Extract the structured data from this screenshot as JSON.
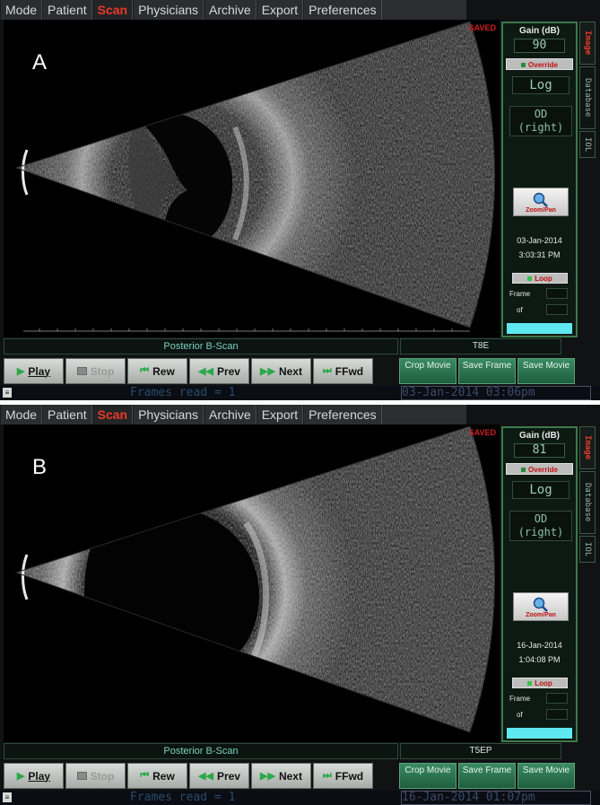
{
  "menu": [
    "Mode",
    "Patient",
    "Scan",
    "Physicians",
    "Archive",
    "Export",
    "Preferences"
  ],
  "active_menu": "Scan",
  "vertical_tabs": [
    "Image",
    "Database",
    "IOL"
  ],
  "controls": {
    "play": "Play",
    "stop": "Stop",
    "rew": "Rew",
    "prev": "Prev",
    "next": "Next",
    "ffwd": "FFwd"
  },
  "actions": {
    "crop_movie": "Crop Movie",
    "save_frame": "Save Frame",
    "save_movie": "Save Movie"
  },
  "sidebar_labels": {
    "gain": "Gain (dB)",
    "override": "Override",
    "zoom": "Zoom/Pan",
    "loop": "Loop",
    "frame": "Frame",
    "of": "of"
  },
  "colors": {
    "active_menu": "#e83a2a",
    "sidebar_border": "#3c7a4a",
    "action_button": "#2f7a52",
    "progress_bar": "#5fe8f0",
    "saved": "#d02020"
  },
  "panels": [
    {
      "letter": "A",
      "saved": "SAVED",
      "gain": "90",
      "mode": "Log",
      "eye_line1": "OD",
      "eye_line2": "(right)",
      "date": "03-Jan-2014",
      "time": "3:03:31 PM",
      "scan_type": "Posterior B-Scan",
      "probe": "T8E",
      "frames_read": "Frames read = 1",
      "footer_datetime": "03-Jan-2014 03:06pm"
    },
    {
      "letter": "B",
      "saved": "SAVED",
      "gain": "81",
      "mode": "Log",
      "eye_line1": "OD",
      "eye_line2": "(right)",
      "date": "16-Jan-2014",
      "time": "1:04:08 PM",
      "scan_type": "Posterior B-Scan",
      "probe": "T5EP",
      "frames_read": "Frames read = 1",
      "footer_datetime": "16-Jan-2014 01:07pm"
    }
  ]
}
